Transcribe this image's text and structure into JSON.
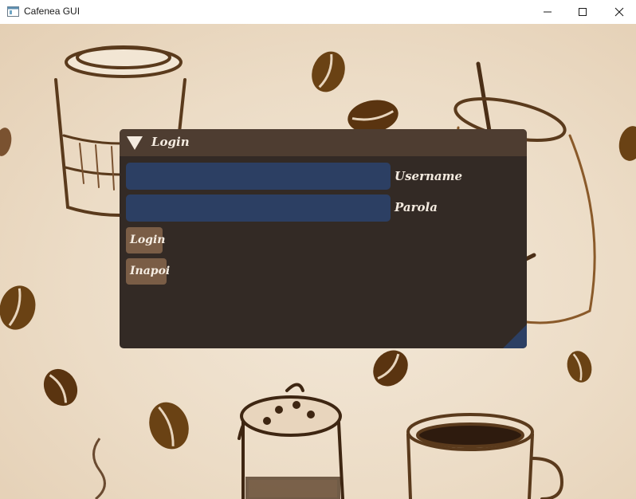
{
  "window": {
    "title": "Cafenea GUI",
    "icon": "app-window-icon",
    "controls": [
      "minimize-icon",
      "maximize-icon",
      "close-icon"
    ]
  },
  "login": {
    "title": "Login",
    "collapse_icon": "triangle-down-icon",
    "username": {
      "label": "Username",
      "value": "",
      "placeholder": ""
    },
    "password": {
      "label": "Parola",
      "value": "",
      "placeholder": ""
    },
    "buttons": {
      "login": "Login",
      "back": "Inapoi"
    }
  },
  "colors": {
    "header": "#4e3d31",
    "panel": "#332a25",
    "field": "#2c3f63",
    "button": "#7a5d46",
    "text": "#f4ebe0",
    "resize_grip": "#2c3f63"
  }
}
